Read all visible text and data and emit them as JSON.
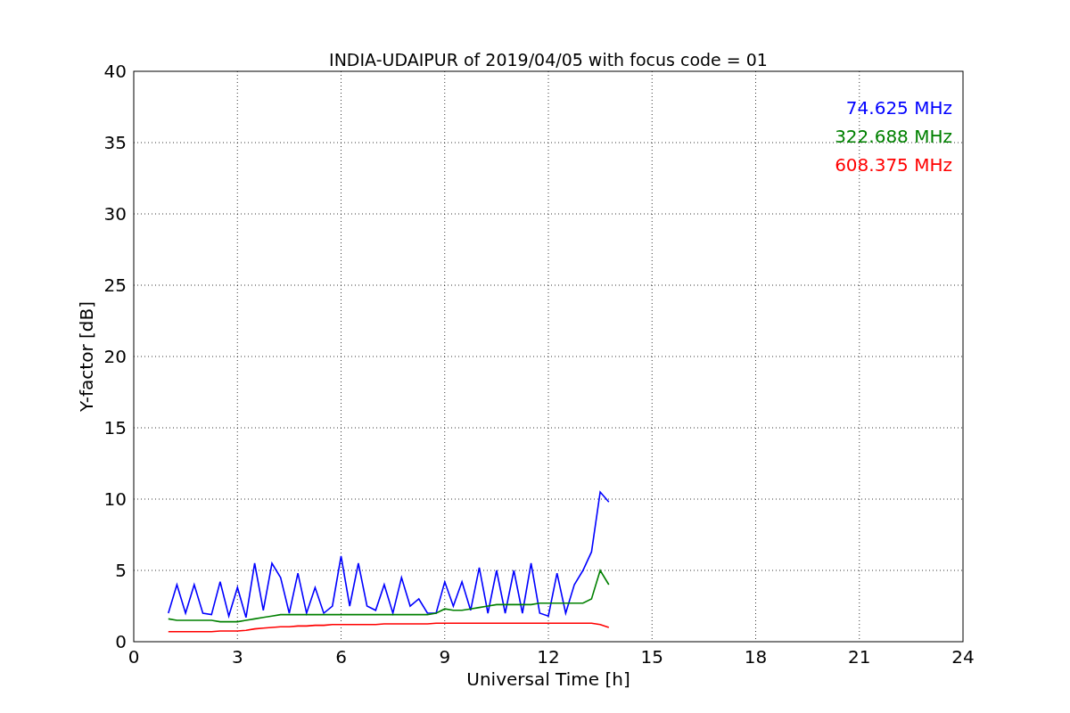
{
  "chart_data": {
    "type": "line",
    "title": "INDIA-UDAIPUR of 2019/04/05 with focus code = 01",
    "xlabel": "Universal Time [h]",
    "ylabel": "Y-factor [dB]",
    "grid": true,
    "xlim": [
      0,
      24
    ],
    "ylim": [
      0,
      40
    ],
    "xticks": [
      0,
      3,
      6,
      9,
      12,
      15,
      18,
      21,
      24
    ],
    "yticks": [
      0,
      5,
      10,
      15,
      20,
      25,
      30,
      35,
      40
    ],
    "x": [
      1.0,
      1.25,
      1.5,
      1.75,
      2.0,
      2.25,
      2.5,
      2.75,
      3.0,
      3.25,
      3.5,
      3.75,
      4.0,
      4.25,
      4.5,
      4.75,
      5.0,
      5.25,
      5.5,
      5.75,
      6.0,
      6.25,
      6.5,
      6.75,
      7.0,
      7.25,
      7.5,
      7.75,
      8.0,
      8.25,
      8.5,
      8.75,
      9.0,
      9.25,
      9.5,
      9.75,
      10.0,
      10.25,
      10.5,
      10.75,
      11.0,
      11.25,
      11.5,
      11.75,
      12.0,
      12.25,
      12.5,
      12.75,
      13.0,
      13.25,
      13.5,
      13.75
    ],
    "series": [
      {
        "name": "74.625 MHz",
        "color": "#0000ff",
        "values": [
          2,
          4,
          2,
          4,
          2,
          1.9,
          4.2,
          1.8,
          3.8,
          1.7,
          5.5,
          2.2,
          5.5,
          4.5,
          2,
          4.8,
          2,
          3.8,
          2,
          2.5,
          6,
          2.5,
          5.5,
          2.5,
          2.2,
          4,
          2,
          4.5,
          2.5,
          3,
          2,
          2,
          4.2,
          2.5,
          4.2,
          2.2,
          5.2,
          2,
          5,
          2,
          5,
          2,
          5.5,
          2,
          1.8,
          4.8,
          2,
          4,
          5,
          6.3,
          10.5,
          9.8
        ]
      },
      {
        "name": "322.688 MHz",
        "color": "#008000",
        "values": [
          1.6,
          1.5,
          1.5,
          1.5,
          1.5,
          1.5,
          1.4,
          1.4,
          1.4,
          1.5,
          1.6,
          1.7,
          1.8,
          1.9,
          1.9,
          1.9,
          1.9,
          1.9,
          1.9,
          1.9,
          1.9,
          1.9,
          1.9,
          1.9,
          1.9,
          1.9,
          1.9,
          1.9,
          1.9,
          1.9,
          1.9,
          2.0,
          2.3,
          2.2,
          2.2,
          2.3,
          2.4,
          2.5,
          2.6,
          2.6,
          2.6,
          2.6,
          2.6,
          2.7,
          2.7,
          2.7,
          2.7,
          2.7,
          2.7,
          3.0,
          5.0,
          4.0
        ]
      },
      {
        "name": "608.375 MHz",
        "color": "#ff0000",
        "values": [
          0.7,
          0.7,
          0.7,
          0.7,
          0.7,
          0.7,
          0.75,
          0.75,
          0.75,
          0.8,
          0.9,
          0.95,
          1.0,
          1.05,
          1.05,
          1.1,
          1.1,
          1.15,
          1.15,
          1.2,
          1.2,
          1.2,
          1.2,
          1.2,
          1.2,
          1.25,
          1.25,
          1.25,
          1.25,
          1.25,
          1.25,
          1.3,
          1.3,
          1.3,
          1.3,
          1.3,
          1.3,
          1.3,
          1.3,
          1.3,
          1.3,
          1.3,
          1.3,
          1.3,
          1.3,
          1.3,
          1.3,
          1.3,
          1.3,
          1.3,
          1.2,
          1.0
        ]
      }
    ]
  }
}
